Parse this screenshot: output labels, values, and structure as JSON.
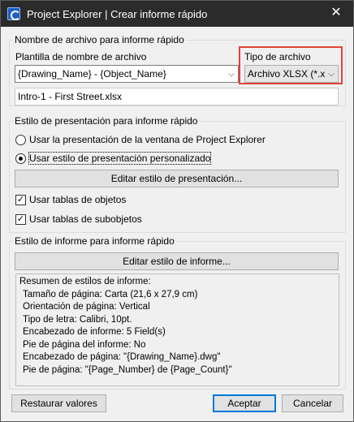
{
  "window": {
    "title": "Project Explorer | Crear informe rápido",
    "close_glyph": "✕"
  },
  "filename_group": {
    "legend": "Nombre de archivo para informe rápido",
    "template_label": "Plantilla de nombre de archivo",
    "template_value": "{Drawing_Name} - {Object_Name}",
    "filetype_label": "Tipo de archivo",
    "filetype_value": "Archivo XLSX (*.xlsx",
    "preview": "Intro-1 - First Street.xlsx"
  },
  "presentation_group": {
    "legend": "Estilo de presentación para informe rápido",
    "radio_project": "Usar la presentación de la ventana de Project Explorer",
    "radio_custom": "Usar estilo de presentación personalizado",
    "edit_button": "Editar estilo de presentación...",
    "check_objects": "Usar tablas de objetos",
    "check_subobjects": "Usar tablas de subobjetos"
  },
  "report_group": {
    "legend": "Estilo de informe para informe rápido",
    "edit_button": "Editar estilo de informe...",
    "summary_title": "Resumen de estilos de informe:",
    "summary_lines": [
      "Tamaño de página: Carta (21,6 x 27,9 cm)",
      "Orientación de página: Vertical",
      "Tipo de letra: Calibri, 10pt.",
      "Encabezado de informe: 5 Field(s)",
      "Pie de página del informe: No",
      "Encabezado de página: \"{Drawing_Name}.dwg\"",
      "Pie de página: \"{Page_Number} de {Page_Count}\""
    ]
  },
  "footer": {
    "restore": "Restaurar valores",
    "accept": "Aceptar",
    "cancel": "Cancelar"
  },
  "icons": {
    "chevron": "⌵",
    "check": "✓"
  },
  "colors": {
    "highlight": "#e0443a",
    "accent": "#0078d7"
  }
}
